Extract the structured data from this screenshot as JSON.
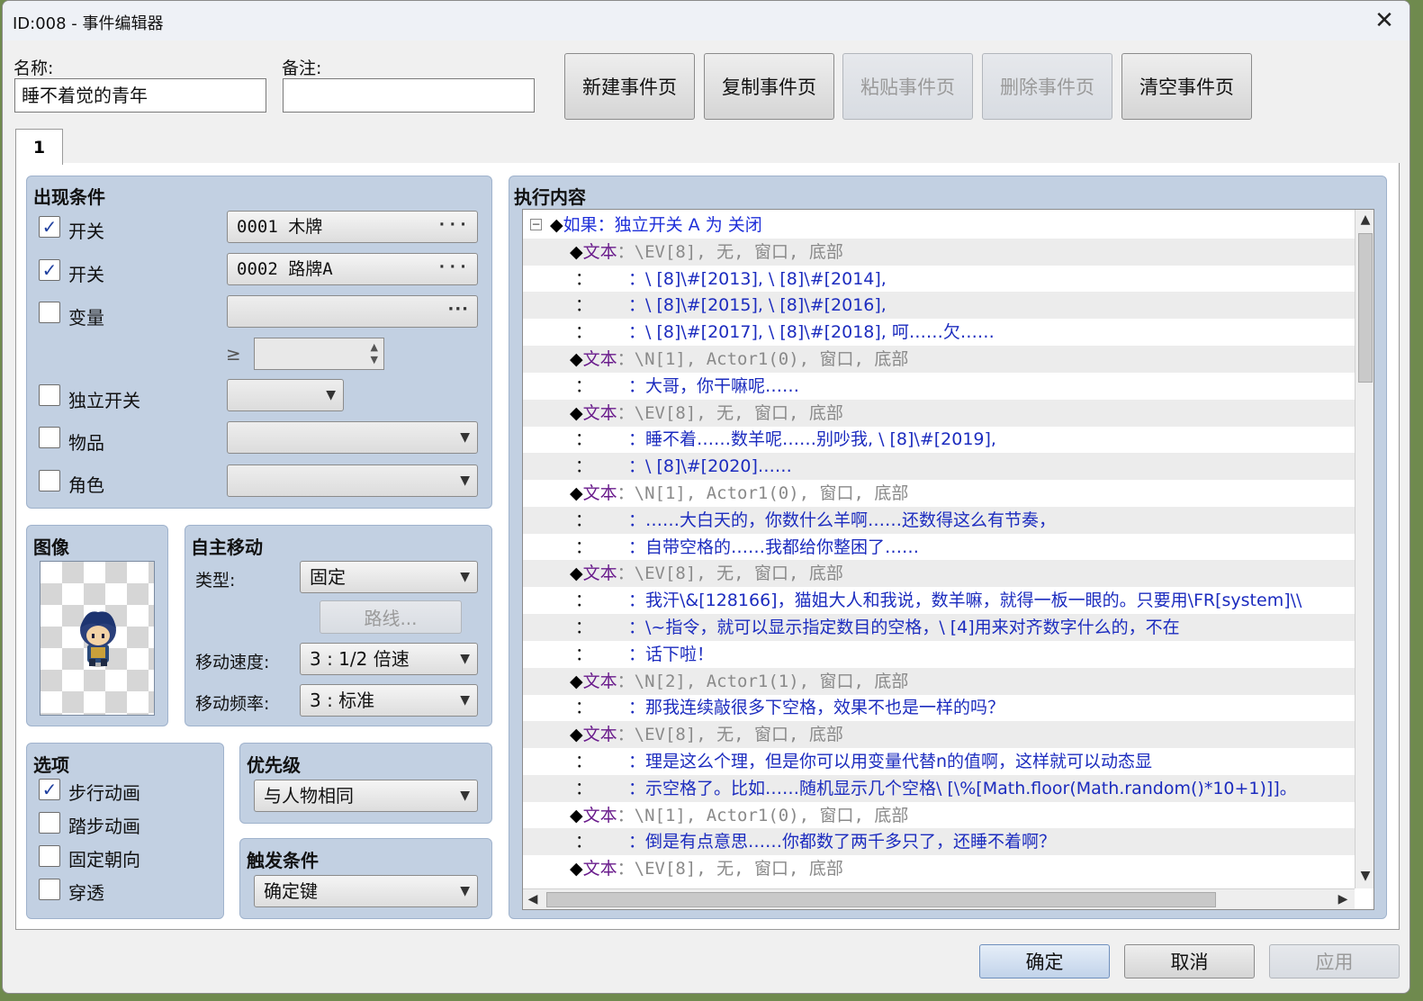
{
  "window": {
    "title": "ID:008 - 事件编辑器",
    "close_glyph": "✕"
  },
  "header": {
    "name_label": "名称:",
    "name_value": "睡不着觉的青年",
    "note_label": "备注:",
    "note_value": "",
    "buttons": {
      "new_page": "新建事件页",
      "copy_page": "复制事件页",
      "paste_page": "粘贴事件页",
      "delete_page": "删除事件页",
      "clear_page": "清空事件页"
    }
  },
  "tabs": [
    {
      "label": "1"
    }
  ],
  "conditions": {
    "title": "出现条件",
    "switch1": {
      "label": "开关",
      "checked": true,
      "value": "0001 木牌"
    },
    "switch2": {
      "label": "开关",
      "checked": true,
      "value": "0002 路牌A"
    },
    "variable": {
      "label": "变量",
      "checked": false,
      "value": "",
      "ge": "≥"
    },
    "self_switch": {
      "label": "独立开关",
      "checked": false
    },
    "item": {
      "label": "物品",
      "checked": false
    },
    "actor": {
      "label": "角色",
      "checked": false
    },
    "check_glyph": "✓",
    "dots_glyph": "···",
    "arrow_glyph": "▼"
  },
  "image": {
    "title": "图像"
  },
  "autonomous": {
    "title": "自主移动",
    "type_label": "类型:",
    "type_value": "固定",
    "route_button": "路线...",
    "speed_label": "移动速度:",
    "speed_value": "3 : 1/2 倍速",
    "freq_label": "移动频率:",
    "freq_value": "3 : 标准"
  },
  "options": {
    "title": "选项",
    "walking": {
      "label": "步行动画",
      "checked": true
    },
    "stepping": {
      "label": "踏步动画",
      "checked": false
    },
    "direction_fix": {
      "label": "固定朝向",
      "checked": false
    },
    "through": {
      "label": "穿透",
      "checked": false
    }
  },
  "priority": {
    "title": "优先级",
    "value": "与人物相同"
  },
  "trigger": {
    "title": "触发条件",
    "value": "确定键"
  },
  "contents": {
    "title": "执行内容",
    "fold_glyph": "−",
    "lines": [
      {
        "kind": "if",
        "marker": "◆",
        "keyword": "如果",
        "text": "：独立开关 A 为 关闭"
      },
      {
        "kind": "text",
        "marker": "◆",
        "keyword": "文本",
        "text": "：\\EV[8], 无, 窗口, 底部"
      },
      {
        "kind": "cont",
        "colon": "：",
        "text": "：\\ [8]\\#[2013], \\ [8]\\#[2014],"
      },
      {
        "kind": "cont",
        "colon": "：",
        "text": "：\\ [8]\\#[2015], \\ [8]\\#[2016],"
      },
      {
        "kind": "cont",
        "colon": "：",
        "text": "：\\ [8]\\#[2017], \\ [8]\\#[2018], 呵……欠……"
      },
      {
        "kind": "text",
        "marker": "◆",
        "keyword": "文本",
        "text": "：\\N[1], Actor1(0), 窗口, 底部"
      },
      {
        "kind": "cont",
        "colon": "：",
        "text": "：大哥，你干嘛呢……"
      },
      {
        "kind": "text",
        "marker": "◆",
        "keyword": "文本",
        "text": "：\\EV[8], 无, 窗口, 底部"
      },
      {
        "kind": "cont",
        "colon": "：",
        "text": "：睡不着……数羊呢……别吵我, \\ [8]\\#[2019],"
      },
      {
        "kind": "cont",
        "colon": "：",
        "text": "：\\ [8]\\#[2020]……"
      },
      {
        "kind": "text",
        "marker": "◆",
        "keyword": "文本",
        "text": "：\\N[1], Actor1(0), 窗口, 底部"
      },
      {
        "kind": "cont",
        "colon": "：",
        "text": "：……大白天的，你数什么羊啊……还数得这么有节奏，"
      },
      {
        "kind": "cont",
        "colon": "：",
        "text": "：自带空格的……我都给你整困了……"
      },
      {
        "kind": "text",
        "marker": "◆",
        "keyword": "文本",
        "text": "：\\EV[8], 无, 窗口, 底部"
      },
      {
        "kind": "cont",
        "colon": "：",
        "text": "：我汗\\&[128166]，猫姐大人和我说，数羊嘛，就得一板一眼的。只要用\\FR[system]\\\\"
      },
      {
        "kind": "cont",
        "colon": "：",
        "text": "：\\~指令，就可以显示指定数目的空格，\\ [4]用来对齐数字什么的，不在"
      },
      {
        "kind": "cont",
        "colon": "：",
        "text": "：话下啦！"
      },
      {
        "kind": "text",
        "marker": "◆",
        "keyword": "文本",
        "text": "：\\N[2], Actor1(1), 窗口, 底部"
      },
      {
        "kind": "cont",
        "colon": "：",
        "text": "：那我连续敲很多下空格，效果不也是一样的吗？"
      },
      {
        "kind": "text",
        "marker": "◆",
        "keyword": "文本",
        "text": "：\\EV[8], 无, 窗口, 底部"
      },
      {
        "kind": "cont",
        "colon": "：",
        "text": "：理是这么个理，但是你可以用变量代替n的值啊，这样就可以动态显"
      },
      {
        "kind": "cont",
        "colon": "：",
        "text": "：示空格了。比如……随机显示几个空格\\ [\\%[Math.floor(Math.random()*10+1)]]。"
      },
      {
        "kind": "text",
        "marker": "◆",
        "keyword": "文本",
        "text": "：\\N[1], Actor1(0), 窗口, 底部"
      },
      {
        "kind": "cont",
        "colon": "：",
        "text": "：倒是有点意思……你都数了两千多只了，还睡不着啊？"
      },
      {
        "kind": "text",
        "marker": "◆",
        "keyword": "文本",
        "text": "：\\EV[8], 无, 窗口, 底部"
      }
    ],
    "scroll": {
      "up": "▲",
      "down": "▼",
      "left": "◀",
      "right": "▶"
    }
  },
  "footer": {
    "ok": "确定",
    "cancel": "取消",
    "apply": "应用"
  },
  "colors": {
    "group_bg": "#c2d0e2",
    "if_keyword": "#1e2fd9",
    "text_keyword": "#6a1c8c",
    "content_blue": "#1c2cbf"
  }
}
